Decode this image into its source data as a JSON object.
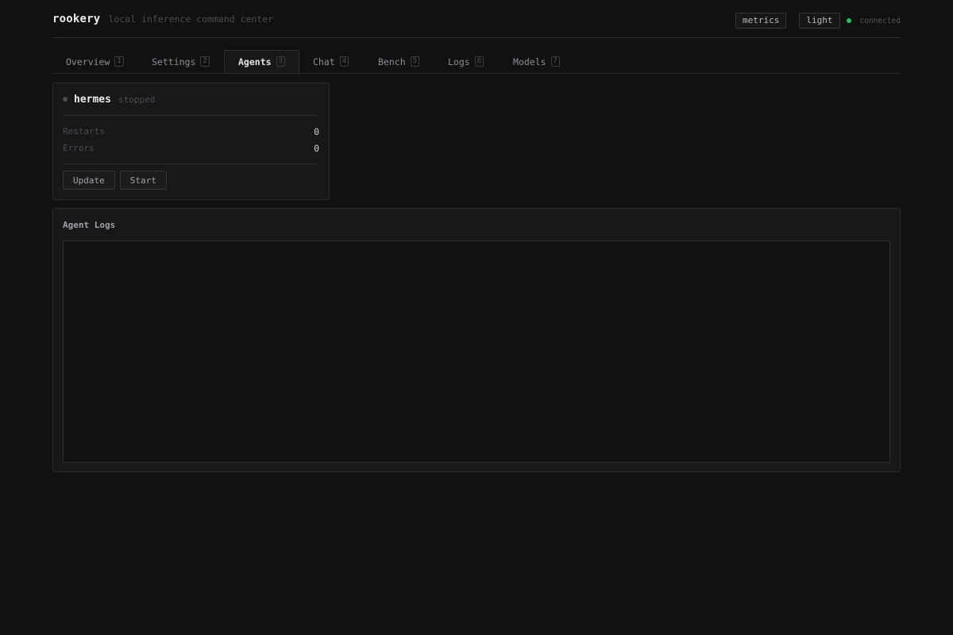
{
  "header": {
    "brand": "rookery",
    "tagline": "local inference command center",
    "metrics_label": "metrics",
    "theme_label": "light",
    "status_text": "connected",
    "status_color": "#22c55e"
  },
  "tabs": [
    {
      "label": "Overview",
      "key": "1",
      "active": false
    },
    {
      "label": "Settings",
      "key": "2",
      "active": false
    },
    {
      "label": "Agents",
      "key": "3",
      "active": true
    },
    {
      "label": "Chat",
      "key": "4",
      "active": false
    },
    {
      "label": "Bench",
      "key": "5",
      "active": false
    },
    {
      "label": "Logs",
      "key": "6",
      "active": false
    },
    {
      "label": "Models",
      "key": "7",
      "active": false
    }
  ],
  "agent": {
    "name": "hermes",
    "state": "stopped",
    "stats": [
      {
        "label": "Restarts",
        "value": "0"
      },
      {
        "label": "Errors",
        "value": "0"
      }
    ],
    "update_label": "Update",
    "start_label": "Start"
  },
  "logs": {
    "title": "Agent Logs",
    "content": ""
  }
}
